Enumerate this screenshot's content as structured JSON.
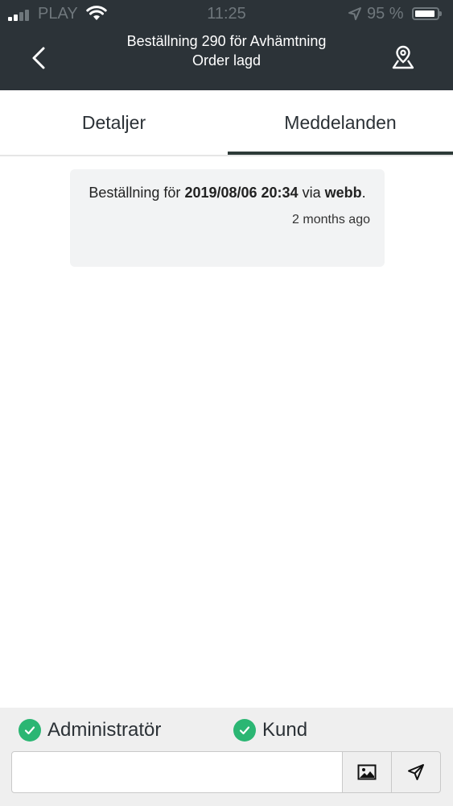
{
  "status_bar": {
    "carrier": "PLAY",
    "time": "11:25",
    "battery_text": "95 %",
    "icons": [
      "signal-icon",
      "wifi-icon",
      "location-arrow-icon",
      "battery-icon"
    ]
  },
  "header": {
    "title_line1": "Beställning 290 för Avhämtning",
    "title_line2": "Order lagd",
    "back_icon": "chevron-left-icon",
    "map_icon": "map-pin-icon"
  },
  "tabs": {
    "details": "Detaljer",
    "messages": "Meddelanden",
    "active": "messages"
  },
  "messages": [
    {
      "text_prefix": "Beställning för ",
      "date": "2019/08/06 20:34",
      "text_middle": " via ",
      "channel": "webb",
      "text_suffix": ".",
      "time_ago": "2 months ago"
    }
  ],
  "composer": {
    "recipients": [
      {
        "label": "Administratör",
        "checked": true
      },
      {
        "label": "Kund",
        "checked": true
      }
    ],
    "input_value": "",
    "input_placeholder": "",
    "image_icon": "image-icon",
    "send_icon": "send-icon"
  },
  "colors": {
    "header_bg": "#2c3338",
    "tab_indicator": "#2d3a38",
    "check_green": "#2bb673",
    "bubble_bg": "#f2f3f4",
    "composer_bg": "#efefef"
  }
}
